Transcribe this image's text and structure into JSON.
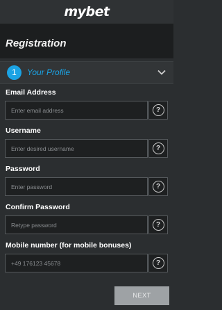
{
  "header": {
    "logo": "mybet"
  },
  "page": {
    "title": "Registration"
  },
  "step": {
    "number": "1",
    "label": "Your Profile",
    "icon": "chevron-down-icon"
  },
  "form": {
    "email": {
      "label": "Email Address",
      "placeholder": "Enter email address",
      "value": ""
    },
    "username": {
      "label": "Username",
      "placeholder": "Enter desired username",
      "value": ""
    },
    "password": {
      "label": "Password",
      "placeholder": "Enter password",
      "value": ""
    },
    "confirm_password": {
      "label": "Confirm Password",
      "placeholder": "Retype password",
      "value": ""
    },
    "mobile": {
      "label": "Mobile number (for mobile bonuses)",
      "placeholder": "+49 176123 45678",
      "value": ""
    },
    "help_glyph": "?"
  },
  "actions": {
    "next_label": "NEXT"
  },
  "colors": {
    "accent": "#1ba3e4",
    "background": "#2b2e30",
    "button": "#9ea2a5"
  }
}
